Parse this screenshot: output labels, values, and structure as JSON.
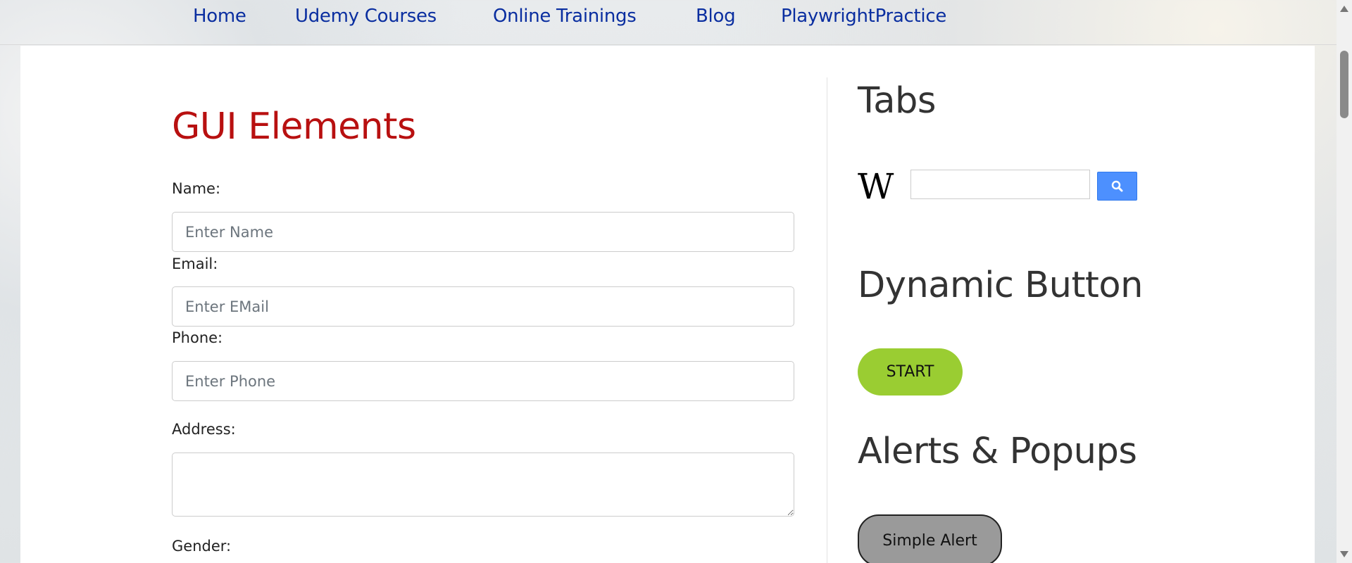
{
  "nav": {
    "items": [
      "Home",
      "Udemy Courses",
      "Online Trainings",
      "Blog",
      "PlaywrightPractice"
    ]
  },
  "gui": {
    "title": "GUI Elements",
    "name_label": "Name:",
    "name_placeholder": "Enter Name",
    "email_label": "Email:",
    "email_placeholder": "Enter EMail",
    "phone_label": "Phone:",
    "phone_placeholder": "Enter Phone",
    "address_label": "Address:",
    "gender_label": "Gender:"
  },
  "right": {
    "tabs_title": "Tabs",
    "wiki_logo": "W",
    "dynamic_title": "Dynamic Button",
    "start_label": "START",
    "alerts_title": "Alerts & Popups",
    "simple_alert_label": "Simple Alert"
  },
  "colors": {
    "nav_link": "#0a2ea0",
    "title": "#b81010",
    "start": "#9acd32",
    "search_btn": "#4d90fe"
  }
}
